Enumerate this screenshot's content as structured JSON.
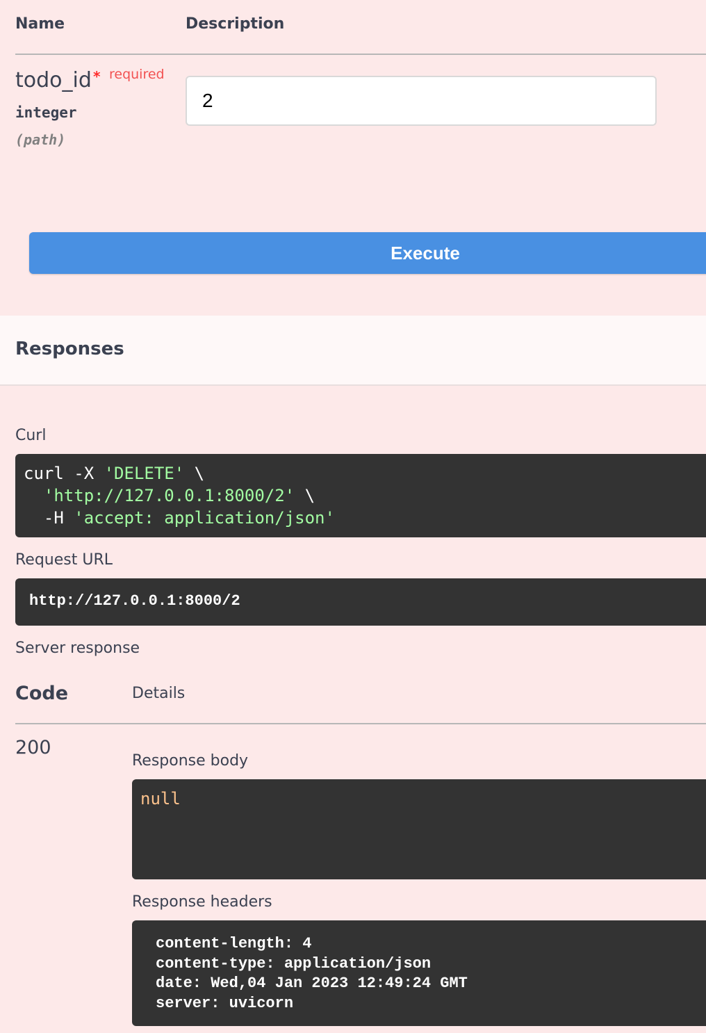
{
  "params": {
    "header_name": "Name",
    "header_description": "Description",
    "items": [
      {
        "name": "todo_id",
        "required_marker": "*",
        "required_label": "required",
        "type": "integer",
        "in": "(path)",
        "value": "2"
      }
    ]
  },
  "execute_label": "Execute",
  "responses": {
    "title": "Responses",
    "curl_label": "Curl",
    "curl": {
      "line1_cmd": "curl -X ",
      "line1_str": "'DELETE'",
      "line1_end": " \\",
      "line2_indent": "  ",
      "line2_str": "'http://127.0.0.1:8000/2'",
      "line2_end": " \\",
      "line3_cmd": "  -H ",
      "line3_str": "'accept: application/json'"
    },
    "request_url_label": "Request URL",
    "request_url": "http://127.0.0.1:8000/2",
    "server_response_label": "Server response",
    "code_header": "Code",
    "details_header": "Details",
    "code": "200",
    "body_label": "Response body",
    "body": "null",
    "headers_label": "Response headers",
    "headers": [
      "content-length: 4",
      "content-type: application/json",
      "date: Wed,04 Jan 2023 12:49:24 GMT",
      "server: uvicorn"
    ]
  },
  "colors": {
    "background": "#fde9e9",
    "execute_button": "#4990e2",
    "code_block": "#333333",
    "string_literal": "#a2fca2",
    "json_null": "#fcc28c",
    "required": "#f25252"
  }
}
